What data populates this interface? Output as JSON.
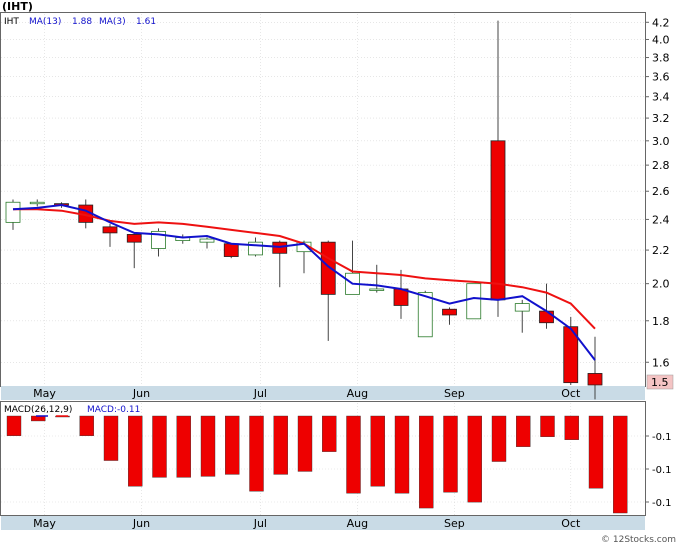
{
  "title": "(IHT)",
  "legend": {
    "symbol": "IHT",
    "ma13_label": "MA(13)",
    "ma13_value": "1.88",
    "ma3_label": "MA(3)",
    "ma3_value": "1.61"
  },
  "macd_legend": {
    "label": "MACD(26,12,9)",
    "value_label": "MACD:-0.11"
  },
  "last_price_label": "1.5",
  "watermark": "© 12Stocks.com",
  "colors": {
    "up": "#ffffff",
    "down": "#ee0000",
    "candle_outline": "#2a7a2a",
    "ma13": "#ee1111",
    "ma3": "#1111cc",
    "axis_band": "#c9dbe6",
    "grid": "#d8d8d8"
  },
  "chart_data": [
    {
      "type": "candlestick",
      "title": "(IHT)",
      "yscale": "log",
      "ylim": [
        1.5,
        4.3
      ],
      "yticks": [
        "1.6",
        "1.8",
        "2.0",
        "2.2",
        "2.4",
        "2.6",
        "2.8",
        "3.0",
        "3.2",
        "3.4",
        "3.6",
        "3.8",
        "4.0",
        "4.2"
      ],
      "xticks": [
        "May",
        "Jun",
        "Jul",
        "Aug",
        "Sep",
        "Oct"
      ],
      "xtick_index": [
        1.3,
        5.3,
        10.2,
        14.2,
        18.2,
        23.0
      ],
      "candles": [
        {
          "o": 2.38,
          "h": 2.54,
          "l": 2.33,
          "c": 2.52
        },
        {
          "o": 2.51,
          "h": 2.54,
          "l": 2.49,
          "c": 2.52
        },
        {
          "o": 2.51,
          "h": 2.52,
          "l": 2.48,
          "c": 2.5
        },
        {
          "o": 2.5,
          "h": 2.54,
          "l": 2.34,
          "c": 2.38
        },
        {
          "o": 2.35,
          "h": 2.37,
          "l": 2.22,
          "c": 2.31
        },
        {
          "o": 2.3,
          "h": 2.31,
          "l": 2.09,
          "c": 2.25
        },
        {
          "o": 2.21,
          "h": 2.34,
          "l": 2.16,
          "c": 2.32
        },
        {
          "o": 2.26,
          "h": 2.3,
          "l": 2.24,
          "c": 2.28
        },
        {
          "o": 2.25,
          "h": 2.28,
          "l": 2.21,
          "c": 2.27
        },
        {
          "o": 2.24,
          "h": 2.24,
          "l": 2.15,
          "c": 2.16
        },
        {
          "o": 2.17,
          "h": 2.28,
          "l": 2.16,
          "c": 2.25
        },
        {
          "o": 2.25,
          "h": 2.26,
          "l": 1.98,
          "c": 2.18
        },
        {
          "o": 2.19,
          "h": 2.26,
          "l": 2.06,
          "c": 2.25
        },
        {
          "o": 2.25,
          "h": 2.26,
          "l": 1.7,
          "c": 1.94
        },
        {
          "o": 1.94,
          "h": 2.26,
          "l": 1.94,
          "c": 2.06
        },
        {
          "o": 1.97,
          "h": 2.11,
          "l": 1.95,
          "c": 1.97
        },
        {
          "o": 1.97,
          "h": 2.08,
          "l": 1.81,
          "c": 1.88
        },
        {
          "o": 1.72,
          "h": 1.96,
          "l": 1.72,
          "c": 1.95
        },
        {
          "o": 1.86,
          "h": 1.87,
          "l": 1.78,
          "c": 1.83
        },
        {
          "o": 1.81,
          "h": 2.0,
          "l": 1.81,
          "c": 2.0
        },
        {
          "o": 3.0,
          "h": 4.22,
          "l": 1.82,
          "c": 1.91
        },
        {
          "o": 1.85,
          "h": 1.91,
          "l": 1.74,
          "c": 1.89
        },
        {
          "o": 1.85,
          "h": 2.0,
          "l": 1.76,
          "c": 1.79
        },
        {
          "o": 1.77,
          "h": 1.82,
          "l": 1.5,
          "c": 1.51
        },
        {
          "o": 1.55,
          "h": 1.72,
          "l": 1.44,
          "c": 1.5
        }
      ],
      "series": [
        {
          "name": "MA(13)",
          "values": [
            2.47,
            2.47,
            2.46,
            2.43,
            2.39,
            2.37,
            2.38,
            2.37,
            2.35,
            2.33,
            2.31,
            2.29,
            2.24,
            2.15,
            2.07,
            2.06,
            2.05,
            2.03,
            2.02,
            2.01,
            2.0,
            1.98,
            1.95,
            1.89,
            1.76
          ]
        },
        {
          "name": "MA(3)",
          "values": [
            2.47,
            2.48,
            2.5,
            2.46,
            2.38,
            2.31,
            2.3,
            2.28,
            2.29,
            2.24,
            2.23,
            2.22,
            2.24,
            2.1,
            2.0,
            1.99,
            1.97,
            1.93,
            1.89,
            1.92,
            1.91,
            1.93,
            1.85,
            1.76,
            1.61
          ]
        }
      ]
    },
    {
      "type": "bar",
      "title": "MACD(26,12,9)",
      "yticks": [
        "-0.1",
        "-0.1",
        "-0.1"
      ],
      "xticks": [
        "May",
        "Jun",
        "Jul",
        "Aug",
        "Sep",
        "Oct"
      ],
      "values": [
        -0.02,
        -0.005,
        -0.001,
        -0.02,
        -0.045,
        -0.071,
        -0.062,
        -0.062,
        -0.061,
        -0.059,
        -0.076,
        -0.059,
        -0.056,
        -0.036,
        -0.078,
        -0.071,
        -0.078,
        -0.093,
        -0.077,
        -0.087,
        -0.046,
        -0.031,
        -0.021,
        -0.024,
        -0.073,
        -0.098
      ],
      "ylim": [
        -0.1,
        0.0
      ]
    }
  ]
}
